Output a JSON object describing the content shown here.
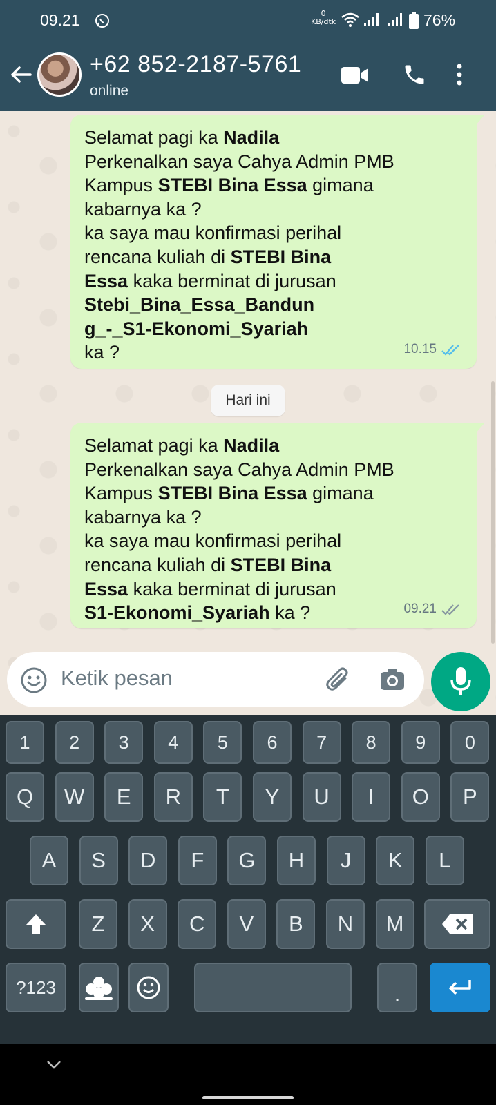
{
  "status_bar": {
    "time": "09.21",
    "net_speed_value": "0",
    "net_speed_unit": "KB/dtk",
    "battery": "76%"
  },
  "header": {
    "title": "+62 852-2187-5761",
    "subtitle": "online"
  },
  "messages": [
    {
      "lines": [
        [
          {
            "t": "Selamat pagi ka "
          },
          {
            "t": "Nadila",
            "b": true
          }
        ],
        [
          {
            "t": "Perkenalkan saya Cahya Admin PMB"
          }
        ],
        [
          {
            "t": "Kampus "
          },
          {
            "t": "STEBI Bina Essa",
            "b": true
          },
          {
            "t": " gimana"
          }
        ],
        [
          {
            "t": "kabarnya ka ?"
          }
        ],
        [
          {
            "t": "ka saya mau konfirmasi perihal"
          }
        ],
        [
          {
            "t": "rencana kuliah di "
          },
          {
            "t": "STEBI Bina",
            "b": true
          }
        ],
        [
          {
            "t": "Essa",
            "b": true
          },
          {
            "t": " kaka berminat di jurusan"
          }
        ],
        [
          {
            "t": "Stebi_Bina_Essa_Bandun",
            "b": true
          }
        ],
        [
          {
            "t": "g_-_S1-Ekonomi_Syariah",
            "b": true
          }
        ],
        [
          {
            "t": "ka ?"
          }
        ]
      ],
      "time": "10.15",
      "read": true
    },
    {
      "lines": [
        [
          {
            "t": "Selamat pagi ka "
          },
          {
            "t": "Nadila",
            "b": true
          }
        ],
        [
          {
            "t": "Perkenalkan saya Cahya Admin PMB"
          }
        ],
        [
          {
            "t": "Kampus "
          },
          {
            "t": "STEBI Bina Essa",
            "b": true
          },
          {
            "t": " gimana"
          }
        ],
        [
          {
            "t": "kabarnya ka ?"
          }
        ],
        [
          {
            "t": "ka saya mau konfirmasi perihal"
          }
        ],
        [
          {
            "t": "rencana kuliah di "
          },
          {
            "t": "STEBI Bina",
            "b": true
          }
        ],
        [
          {
            "t": "Essa",
            "b": true
          },
          {
            "t": " kaka berminat di jurusan"
          }
        ],
        [
          {
            "t": "S1-Ekonomi_Syariah",
            "b": true
          },
          {
            "t": " ka ?"
          }
        ]
      ],
      "time": "09.21",
      "read": false
    }
  ],
  "date_chip": "Hari ini",
  "composer": {
    "placeholder": "Ketik pesan"
  },
  "keyboard": {
    "row_numbers": [
      "1",
      "2",
      "3",
      "4",
      "5",
      "6",
      "7",
      "8",
      "9",
      "0"
    ],
    "row_1": [
      "Q",
      "W",
      "E",
      "R",
      "T",
      "Y",
      "U",
      "I",
      "O",
      "P"
    ],
    "row_2": [
      "A",
      "S",
      "D",
      "F",
      "G",
      "H",
      "J",
      "K",
      "L"
    ],
    "row_3": [
      "Z",
      "X",
      "C",
      "V",
      "B",
      "N",
      "M"
    ],
    "symbols_key": "?123",
    "period_key": "."
  },
  "colors": {
    "header": "#2f4f5f",
    "outgoing_bubble": "#dcf8c6",
    "read_tick": "#53bdeb",
    "mic_button": "#00a884",
    "enter_key": "#1a88d0"
  }
}
